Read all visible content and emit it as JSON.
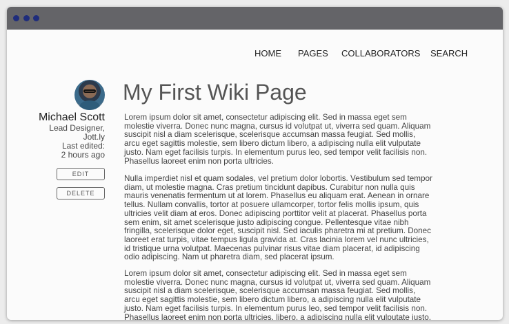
{
  "nav": {
    "home": "HOME",
    "pages": "PAGES",
    "collaborators": "COLLABORATORS",
    "search": "SEARCH"
  },
  "author": {
    "name": "Michael Scott",
    "role_line1": "Lead Designer,",
    "role_line2": "Jott.ly",
    "edited_label": "Last edited:",
    "edited_time": "2 hours ago"
  },
  "actions": {
    "edit": "EDIT",
    "delete": "DELETE"
  },
  "page": {
    "title": "My First Wiki Page",
    "paragraphs": [
      [
        "Lorem ipsum dolor sit amet, consectetur adipiscing elit. Sed in massa eget sem",
        "molestie viverra. Donec nunc magna, cursus id volutpat ut, viverra sed quam. Aliquam",
        "suscipit nisl a diam scelerisque, scelerisque accumsan massa feugiat. Sed mollis,",
        "arcu eget sagittis molestie, sem libero dictum libero, a adipiscing nulla elit vulputate",
        "justo. Nam eget facilisis turpis. In elementum purus leo, sed tempor velit facilisis non.",
        "Phasellus laoreet enim non porta ultricies."
      ],
      [
        "Nulla imperdiet nisl et quam sodales, vel pretium dolor lobortis. Vestibulum sed tempor",
        "diam, ut molestie magna. Cras pretium tincidunt dapibus. Curabitur non nulla quis",
        "mauris venenatis fermentum ut at lorem. Phasellus eu aliquam erat. Aenean in ornare",
        "tellus. Nullam convallis, tortor at posuere ullamcorper, tortor felis mollis ipsum, quis",
        "ultricies velit diam at eros. Donec adipiscing porttitor velit at placerat. Phasellus porta",
        "sem enim, sit amet scelerisque justo adipiscing congue. Pellentesque vitae nibh",
        "fringilla, scelerisque dolor eget, suscipit nisl. Sed iaculis pharetra mi at pretium. Donec",
        "laoreet erat turpis, vitae tempus ligula gravida at. Cras lacinia lorem vel nunc ultricies,",
        "id tristique urna volutpat. Maecenas pulvinar risus vitae diam placerat, id adipiscing",
        "odio adipiscing. Nam ut pharetra diam, sed placerat ipsum."
      ],
      [
        "Lorem ipsum dolor sit amet, consectetur adipiscing elit. Sed in massa eget sem",
        "molestie viverra. Donec nunc magna, cursus id volutpat ut, viverra sed quam. Aliquam",
        "suscipit nisl a diam scelerisque, scelerisque accumsan massa feugiat. Sed mollis,",
        "arcu eget sagittis molestie, sem libero dictum libero, a adipiscing nulla elit vulputate",
        "justo. Nam eget facilisis turpis. In elementum purus leo, sed tempor velit facilisis non.",
        "Phasellus laoreet enim non porta ultricies. libero, a adipiscing nulla elit vulputate justo."
      ]
    ]
  },
  "colors": {
    "titlebar": "#646468",
    "window_dots": "#1f2d7c",
    "page_background": "#fbfbfb"
  }
}
